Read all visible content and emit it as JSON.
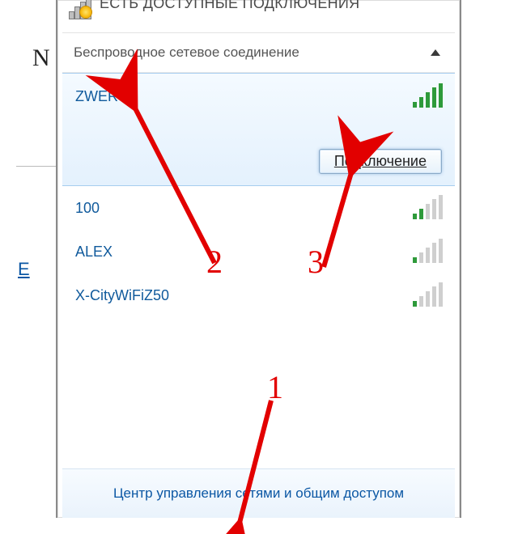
{
  "header": {
    "status_text": "ЕСТЬ ДОСТУПНЫЕ ПОДКЛЮЧЕНИЯ"
  },
  "section": {
    "title": "Беспроводное сетевое соединение"
  },
  "networks": [
    {
      "ssid": "ZWER",
      "signal": 5,
      "selected": true
    },
    {
      "ssid": "100",
      "signal": 2,
      "selected": false
    },
    {
      "ssid": "ALEX",
      "signal": 1,
      "selected": false
    },
    {
      "ssid": "X-CityWiFiZ50",
      "signal": 1,
      "selected": false
    }
  ],
  "connect_button": "Подключение",
  "footer_link": "Центр управления сетями и общим доступом",
  "annotations": {
    "n1": "1",
    "n2": "2",
    "n3": "3"
  },
  "bg": {
    "frag1": "N",
    "frag2": "E"
  }
}
